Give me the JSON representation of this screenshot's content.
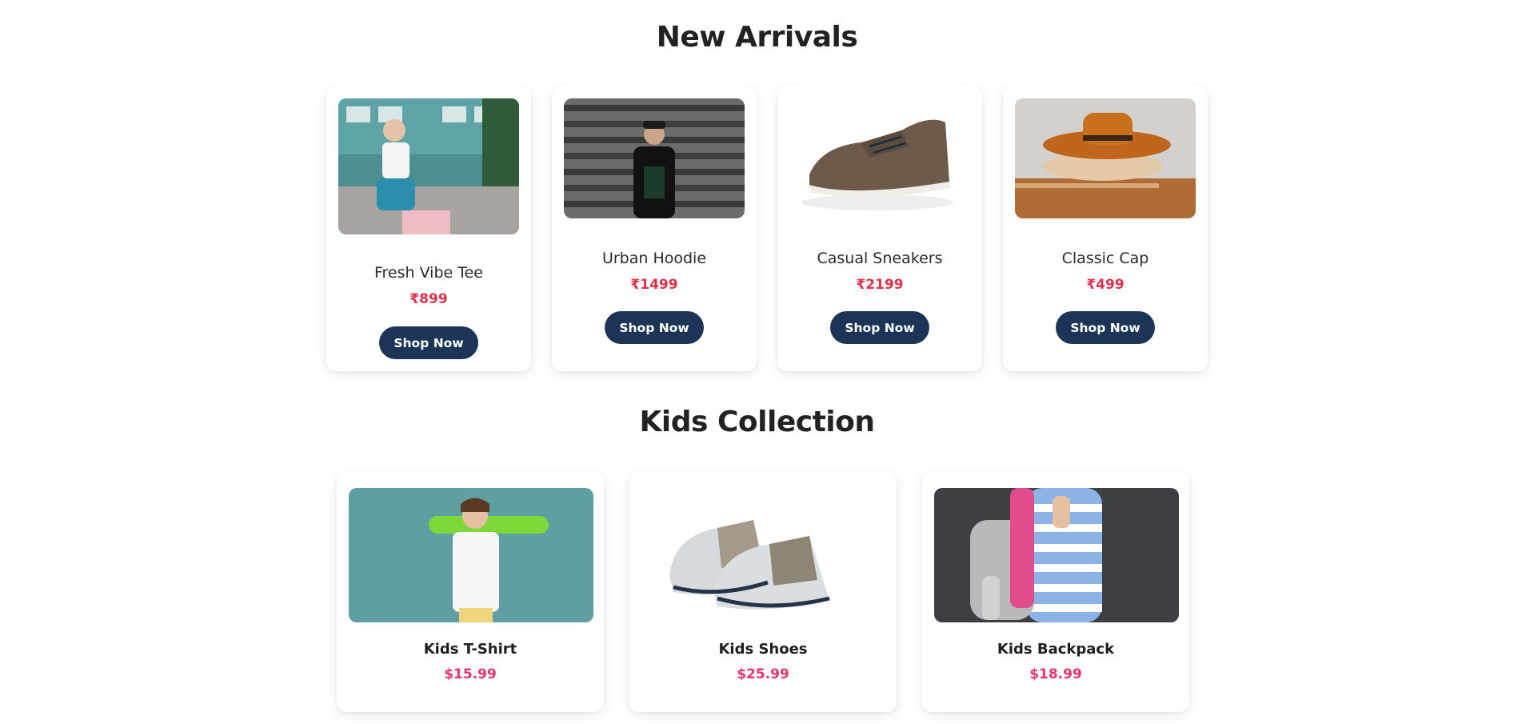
{
  "new_arrivals": {
    "title": "New Arrivals",
    "products": [
      {
        "name": "Fresh Vibe Tee",
        "price": "₹899",
        "button": "Shop Now",
        "image": "woman-white-tee-photo"
      },
      {
        "name": "Urban Hoodie",
        "price": "₹1499",
        "button": "Shop Now",
        "image": "man-black-hoodie-photo"
      },
      {
        "name": "Casual Sneakers",
        "price": "₹2199",
        "button": "Shop Now",
        "image": "brown-sneaker-photo"
      },
      {
        "name": "Classic Cap",
        "price": "₹499",
        "button": "Shop Now",
        "image": "orange-fedora-photo"
      }
    ]
  },
  "kids_collection": {
    "title": "Kids Collection",
    "products": [
      {
        "name": "Kids T-Shirt",
        "price": "$15.99",
        "image": "boy-skateboard-photo"
      },
      {
        "name": "Kids Shoes",
        "price": "$25.99",
        "image": "baby-shoes-photo"
      },
      {
        "name": "Kids Backpack",
        "price": "$18.99",
        "image": "pink-backpack-photo"
      }
    ]
  },
  "colors": {
    "button_bg": "#1c3557",
    "price_red": "#e0314a",
    "price_pink": "#e8346e",
    "heading": "#222222"
  }
}
